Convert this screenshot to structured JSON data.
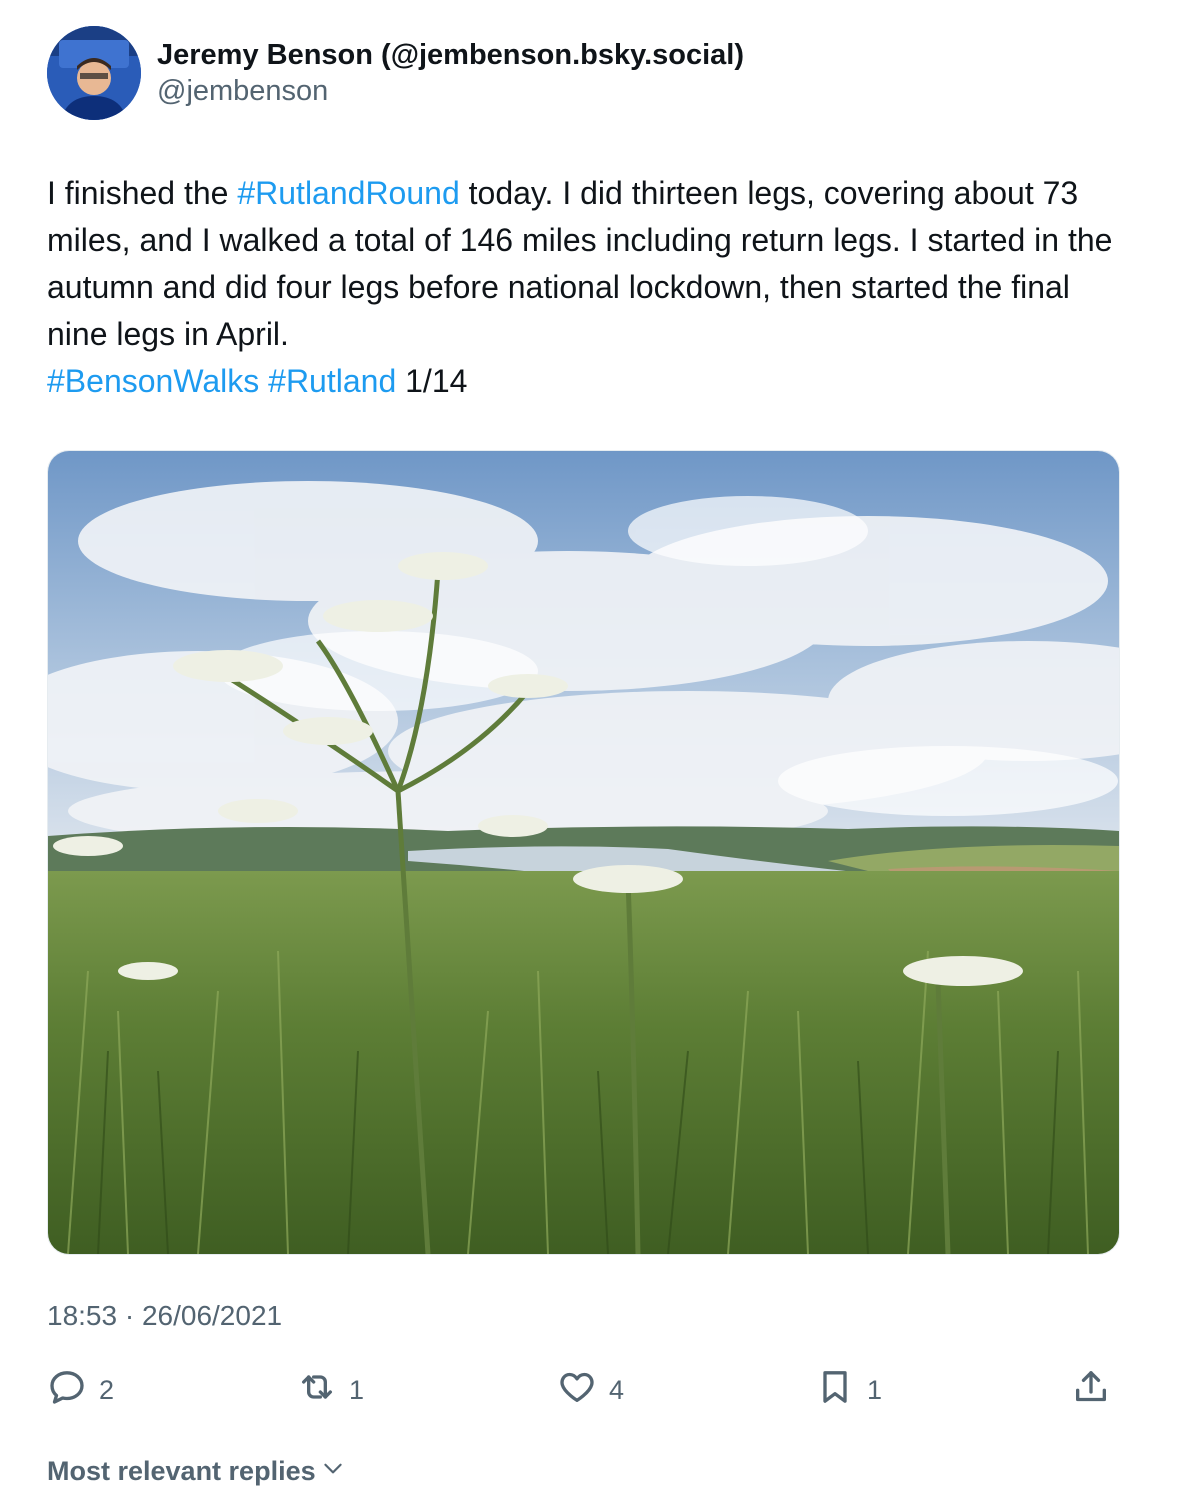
{
  "author": {
    "display_name": "Jeremy Benson (@jembenson.bsky.social)",
    "handle": "@jembenson"
  },
  "tweet": {
    "text_1": "I finished the ",
    "hashtag_1": "#RutlandRound",
    "text_2": " today. I did thirteen legs, covering about 73 miles, and I walked a total of 146 miles including return legs. I started in the autumn and did four legs before national lockdown, then started the final nine legs in April.",
    "hashtag_2": "#BensonWalks",
    "hashtag_3": "#Rutland",
    "text_3": " 1/14",
    "timestamp": "18:53 · 26/06/2021"
  },
  "actions": {
    "replies": "2",
    "reposts": "1",
    "likes": "4",
    "bookmarks": "1"
  },
  "replies_sort": {
    "label": "Most relevant replies"
  },
  "colors": {
    "hashtag": "#1d9bf0",
    "secondary_text": "#536471",
    "primary_text": "#0f1419"
  },
  "icons": [
    "reply-icon",
    "repost-icon",
    "like-icon",
    "bookmark-icon",
    "share-icon",
    "chevron-down-icon"
  ]
}
